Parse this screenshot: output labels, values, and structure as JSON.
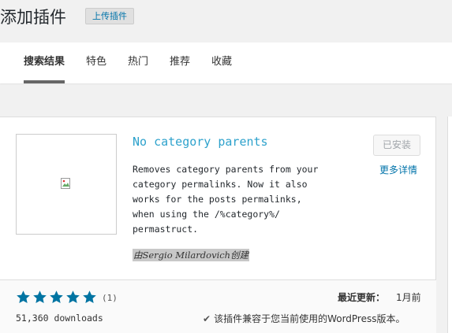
{
  "header": {
    "title": "添加插件",
    "upload_label": "上传插件"
  },
  "filters": {
    "tabs": [
      {
        "label": "搜索结果",
        "current": true
      },
      {
        "label": "特色"
      },
      {
        "label": "热门"
      },
      {
        "label": "推荐"
      },
      {
        "label": "收藏"
      }
    ]
  },
  "plugin": {
    "name": "No category parents",
    "description": "Removes category parents from your category permalinks. Now it also works for the posts permalinks, when using the /%category%/ permastruct.",
    "author": "由Sergio Milardovich创建",
    "action_label": "已安装",
    "more_details_label": "更多详情",
    "rating": 5,
    "rating_count": "(1)",
    "downloads": "51,360 downloads",
    "last_updated_label": "最近更新：",
    "last_updated_value": "1月前",
    "compat_icon": "check-icon",
    "compat_text": "该插件兼容于您当前使用的WordPress版本。"
  },
  "colors": {
    "link": "#0073aa",
    "plugin_name": "#2ea2cc",
    "star": "#0074a2"
  }
}
